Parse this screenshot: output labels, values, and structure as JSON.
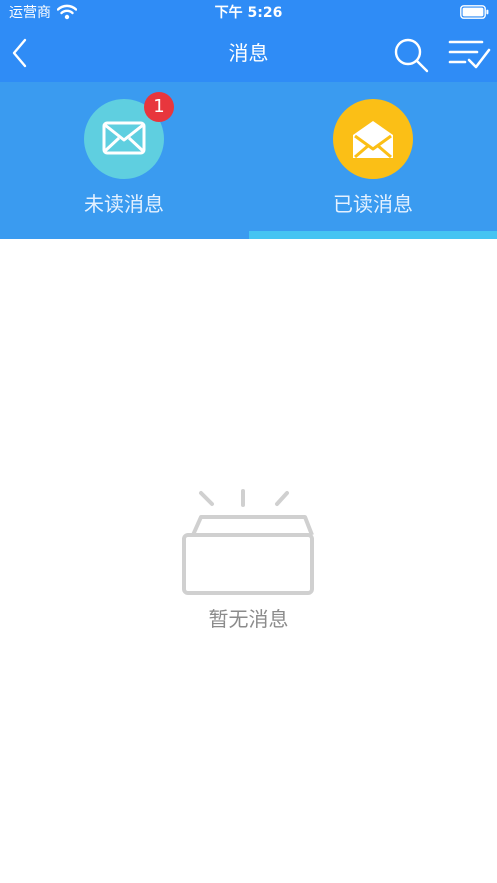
{
  "status_bar": {
    "carrier": "运营商",
    "time": "下午 5:26",
    "wifi_icon": "wifi-icon",
    "battery_icon": "battery-icon"
  },
  "nav": {
    "title": "消息",
    "back_icon": "chevron-left-icon",
    "search_icon": "search-icon",
    "checklist_icon": "checklist-icon",
    "background": "#2f8cf6"
  },
  "tabs": [
    {
      "label": "未读消息",
      "icon": "envelope-closed-icon",
      "icon_color": "#5fcfe0",
      "badge": "1",
      "selected": false
    },
    {
      "label": "已读消息",
      "icon": "envelope-open-icon",
      "icon_color": "#fbbf16",
      "selected": true
    }
  ],
  "colors": {
    "tab_header": "#3a9bf0",
    "tab_indicator": "#45c4f2",
    "badge": "#e8363d"
  },
  "empty_state": {
    "icon": "empty-box-icon",
    "text": "暂无消息"
  }
}
